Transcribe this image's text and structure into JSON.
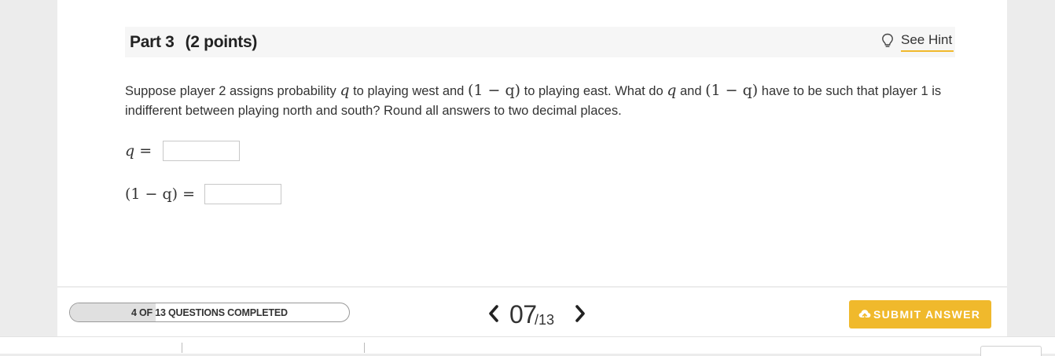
{
  "part": {
    "title": "Part 3",
    "points": "(2 points)",
    "hint_label": "See Hint",
    "hint_icon": "lightbulb-icon"
  },
  "question": {
    "t1": "Suppose player 2 assigns probability ",
    "q": "q",
    "t2": " to playing west and ",
    "expr": "(1 − q)",
    "t3": " to playing east. What do ",
    "t4": " and ",
    "t5": " have to be such that player 1 is indifferent between playing north and south? Round all answers to two decimal places."
  },
  "answers": [
    {
      "label": "q =",
      "value": ""
    },
    {
      "label": "(1 − q) =",
      "value": ""
    }
  ],
  "footer": {
    "progress_text": "4 OF 13 QUESTIONS COMPLETED",
    "progress_fraction": 0.3077,
    "current": "07",
    "total": "/13",
    "prev_icon": "chevron-left-icon",
    "next_icon": "chevron-right-icon",
    "submit_label": "SUBMIT ANSWER",
    "submit_icon": "cloud-upload-icon"
  },
  "colors": {
    "accent": "#f0b92c",
    "page_bg": "#ececec",
    "header_bg": "#f6f6f6",
    "progress_fill": "#e0e0e0"
  }
}
